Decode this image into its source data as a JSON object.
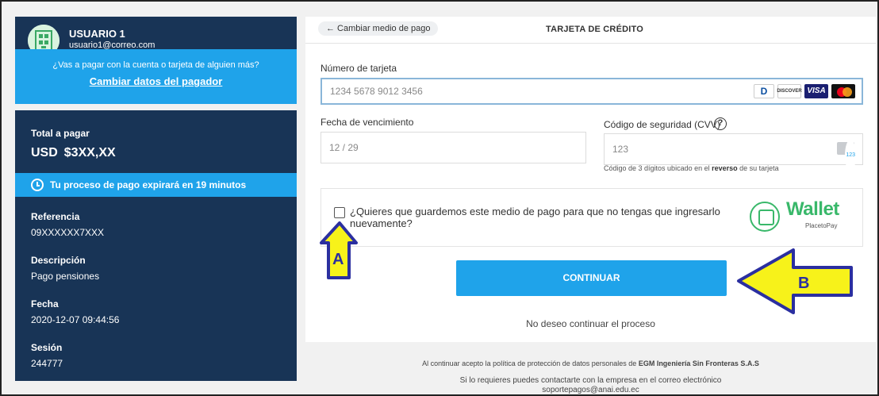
{
  "user": {
    "name": "USUARIO 1",
    "email": "usuario1@correo.com",
    "payer_question": "¿Vas a pagar con la cuenta o tarjeta de alguien más?",
    "change_payer_link": "Cambiar datos del pagador"
  },
  "summary": {
    "total_label": "Total a pagar",
    "currency": "USD",
    "amount": "$3XX,XX",
    "expire_text": "Tu proceso de pago expirará en 19 minutos",
    "fields": [
      {
        "label": "Referencia",
        "value": "09XXXXXX7XXX"
      },
      {
        "label": "Descripción",
        "value": "Pago pensiones"
      },
      {
        "label": "Fecha",
        "value": "2020-12-07 09:44:56"
      },
      {
        "label": "Sesión",
        "value": "244777"
      }
    ]
  },
  "header": {
    "back_link": "← Cambiar medio de pago",
    "title": "TARJETA DE CRÉDITO"
  },
  "form": {
    "card_label": "Número de tarjeta",
    "card_placeholder": "1234 5678 9012 3456",
    "brands": [
      "diners-icon",
      "discover-icon",
      "visa-icon",
      "mastercard-icon"
    ],
    "brand_text": {
      "diners": "D",
      "discover": "DISCOVER",
      "visa": "VISA"
    },
    "exp_label": "Fecha de vencimiento",
    "exp_placeholder": "12 / 29",
    "cvv_label": "Código de seguridad (CVV)",
    "cvv_help": "?",
    "cvv_placeholder": "123",
    "cvv_hint_pre": "Código de 3 dígitos ubicado en el ",
    "cvv_hint_bold": "reverso",
    "cvv_hint_post": " de su tarjeta",
    "wallet_question": "¿Quieres que guardemos este medio de pago para que no tengas que ingresarlo nuevamente?",
    "wallet_brand": "Wallet",
    "wallet_sub": "PlacetoPay",
    "continue_label": "CONTINUAR",
    "cancel_label": "No deseo continuar el proceso"
  },
  "footer": {
    "policy_pre": "Al continuar acepto la política de protección de datos personales de ",
    "policy_company": "EGM Ingeniería Sin Fronteras S.A.S",
    "contact_line1": "Si lo requieres puedes contactarte con la empresa en el correo electrónico",
    "contact_line2": "soportepagos@anai.edu.ec"
  },
  "annotations": {
    "a": "A",
    "b": "B",
    "arrow_color": "#f7f21a",
    "arrow_outline": "#2b2fa0"
  },
  "colors": {
    "navy": "#183456",
    "accent": "#1fa3ea",
    "wallet_green": "#39b86a"
  }
}
